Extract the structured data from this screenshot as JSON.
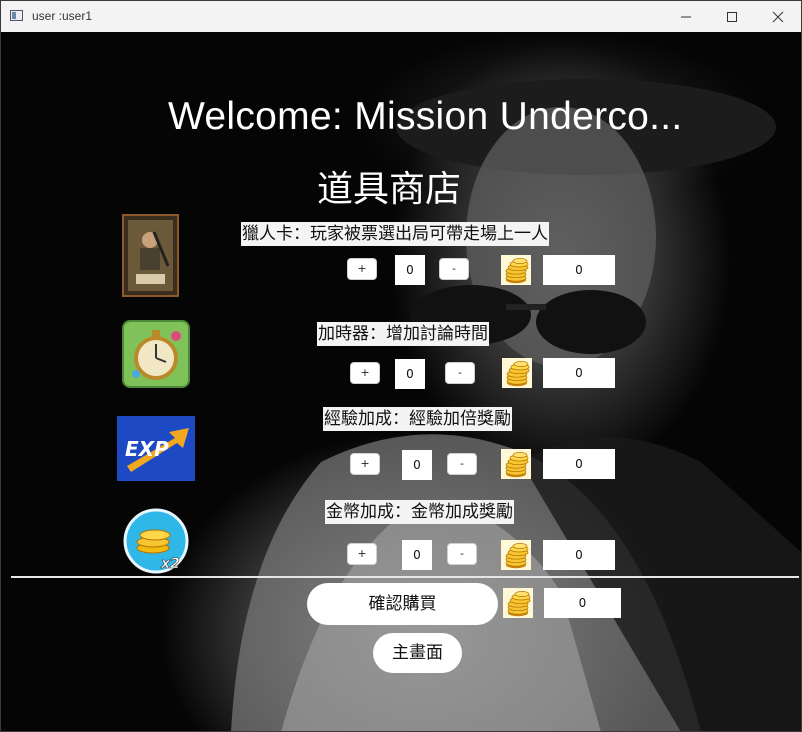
{
  "window": {
    "title": "user :user1",
    "minimize_icon": "minimize-icon",
    "maximize_icon": "maximize-icon",
    "close_icon": "close-icon"
  },
  "header": {
    "welcome": "Welcome: Mission Underco...",
    "shop_title": "道具商店"
  },
  "items": [
    {
      "icon": "hunter-card-icon",
      "description": "獵人卡：玩家被票選出局可帶走場上一人",
      "plus_label": "+",
      "quantity": "0",
      "minus_label": "-",
      "coin_icon": "gold-coins-icon",
      "price": "0"
    },
    {
      "icon": "stopwatch-icon",
      "description": "加時器：增加討論時間",
      "plus_label": "+",
      "quantity": "0",
      "minus_label": "-",
      "coin_icon": "gold-coins-icon",
      "price": "0"
    },
    {
      "icon": "exp-boost-icon",
      "description": "經驗加成：經驗加倍獎勵",
      "plus_label": "+",
      "quantity": "0",
      "minus_label": "-",
      "coin_icon": "gold-coins-icon",
      "price": "0"
    },
    {
      "icon": "coin-x2-icon",
      "description": "金幣加成：金幣加成獎勵",
      "plus_label": "+",
      "quantity": "0",
      "minus_label": "-",
      "coin_icon": "gold-coins-icon",
      "price": "0"
    }
  ],
  "footer": {
    "confirm_label": "確認購買",
    "coin_icon": "gold-coins-icon",
    "total": "0",
    "home_label": "主畫面"
  },
  "colors": {
    "background": "#000000",
    "coin_gold": "#f2b90f",
    "text_box": "#f4f4f4"
  }
}
